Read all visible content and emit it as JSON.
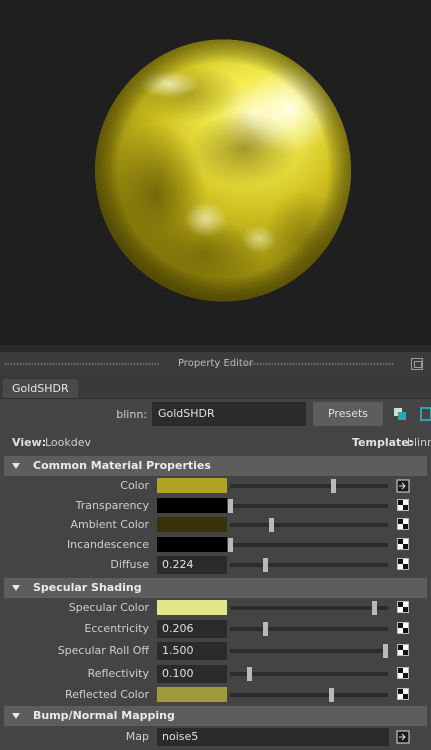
{
  "viewport": {
    "background": "#1f1f1f",
    "preview": "gold-sphere-render"
  },
  "panel": {
    "title": "Property Editor"
  },
  "tab": {
    "label": "GoldSHDR"
  },
  "node": {
    "type_label": "blinn:",
    "name": "GoldSHDR",
    "presets_label": "Presets"
  },
  "view": {
    "label": "View:",
    "value": "Lookdev",
    "template_label": "Template:",
    "template_value": "blinn"
  },
  "sections": {
    "common": {
      "title": "Common Material Properties",
      "attrs": {
        "color": {
          "label": "Color",
          "swatch": "#b1a21f",
          "level": 0.65
        },
        "transparency": {
          "label": "Transparency",
          "swatch": "#000000",
          "level": 0.0
        },
        "ambient": {
          "label": "Ambient Color",
          "swatch": "#37320a",
          "level": 0.26
        },
        "incandescence": {
          "label": "Incandescence",
          "swatch": "#000000",
          "level": 0.0
        },
        "diffuse": {
          "label": "Diffuse",
          "value": "0.224",
          "level": 0.224
        }
      }
    },
    "specular": {
      "title": "Specular Shading",
      "attrs": {
        "specular_color": {
          "label": "Specular Color",
          "swatch": "#e4e68c",
          "level": 0.91
        },
        "eccentricity": {
          "label": "Eccentricity",
          "value": "0.206",
          "level": 0.22
        },
        "roll_off": {
          "label": "Specular Roll Off",
          "value": "1.500",
          "level": 0.98
        },
        "reflectivity": {
          "label": "Reflectivity",
          "value": "0.100",
          "level": 0.12
        },
        "reflected_color": {
          "label": "Reflected Color",
          "swatch": "#9e9b38",
          "level": 0.64
        }
      }
    },
    "bump": {
      "title": "Bump/Normal Mapping",
      "attrs": {
        "map": {
          "label": "Map",
          "value": "noise5"
        }
      }
    }
  },
  "icons": {
    "map_button": "map-input-icon",
    "checker": "checker-texture-icon",
    "float": "float-window-icon"
  }
}
